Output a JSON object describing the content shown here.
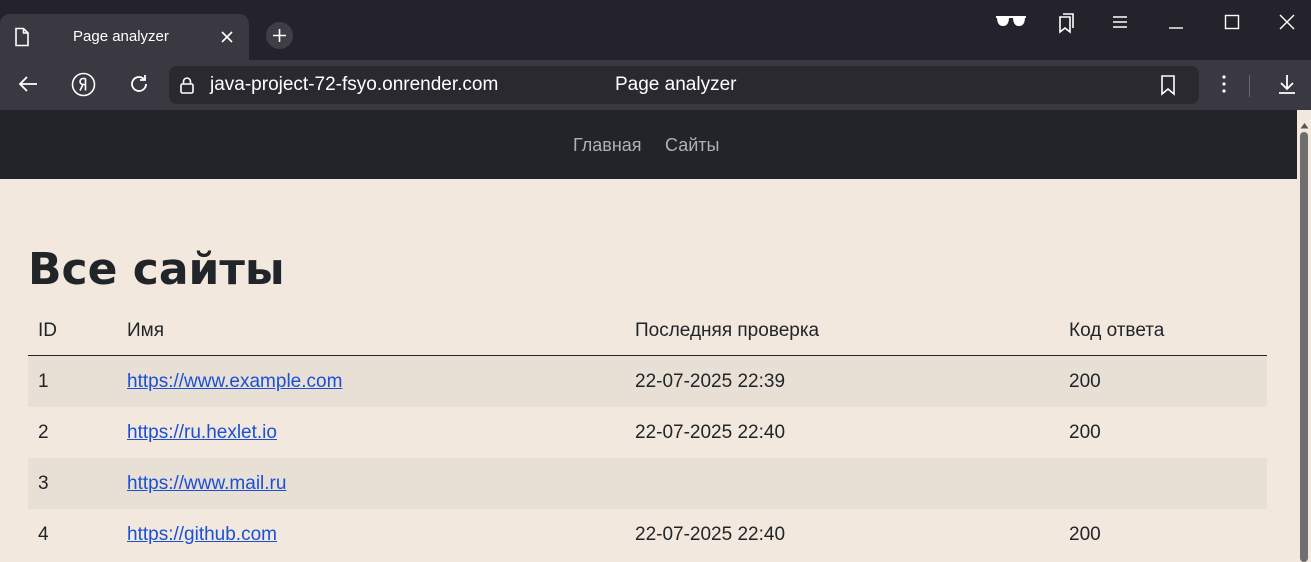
{
  "browser": {
    "tab_title": "Page analyzer",
    "url": "java-project-72-fsyo.onrender.com",
    "address_title": "Page analyzer"
  },
  "nav": {
    "home": "Главная",
    "sites": "Сайты"
  },
  "page": {
    "title": "Все сайты"
  },
  "table": {
    "columns": [
      "ID",
      "Имя",
      "Последняя проверка",
      "Код ответа"
    ],
    "rows": [
      {
        "id": "1",
        "name": "https://www.example.com",
        "last_check": "22-07-2025 22:39",
        "code": "200"
      },
      {
        "id": "2",
        "name": "https://ru.hexlet.io",
        "last_check": "22-07-2025 22:40",
        "code": "200"
      },
      {
        "id": "3",
        "name": "https://www.mail.ru",
        "last_check": "",
        "code": ""
      },
      {
        "id": "4",
        "name": "https://github.com",
        "last_check": "22-07-2025 22:40",
        "code": "200"
      }
    ]
  },
  "colors": {
    "page_bg": "#f2e8dd",
    "navbar_bg": "#212529",
    "link": "#1a4fd6",
    "striped_row": "#e8e0d5"
  }
}
